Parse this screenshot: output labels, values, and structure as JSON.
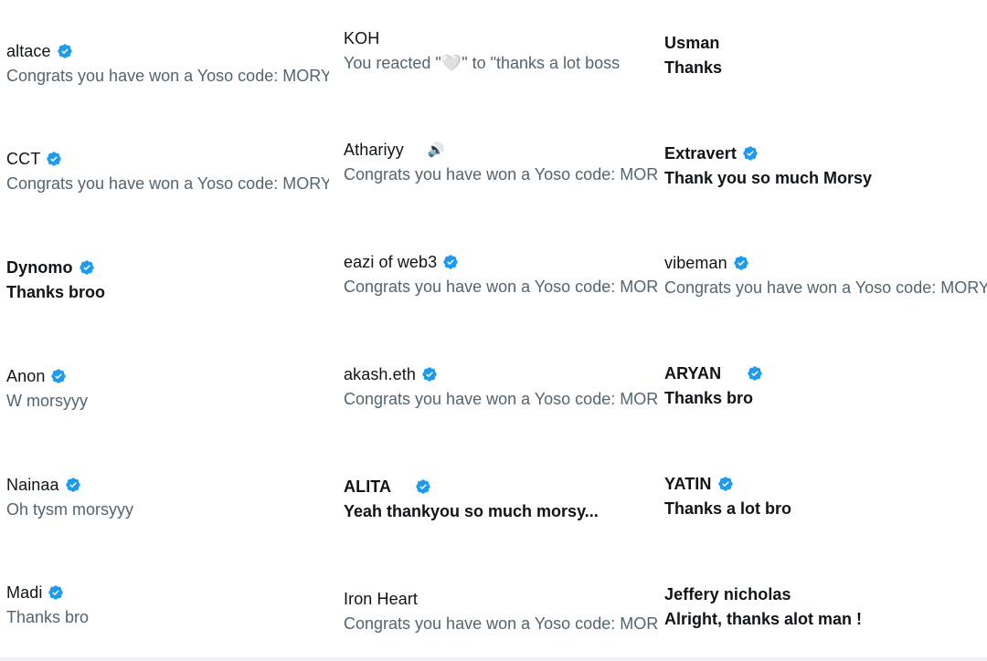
{
  "columns": [
    {
      "items": [
        {
          "name": "altace",
          "verified": true,
          "bold": false,
          "preview": "Congrats you have won a Yoso code: MORYSY",
          "unread": false
        },
        {
          "name": "CCT",
          "verified": true,
          "bold": false,
          "preview": "Congrats you have won a Yoso code: MORYSY",
          "unread": false
        },
        {
          "name": "Dynomo",
          "verified": true,
          "bold": true,
          "preview": "Thanks broo",
          "unread": true
        },
        {
          "name": "Anon",
          "verified": true,
          "bold": false,
          "preview": "W morsyyy",
          "unread": false
        },
        {
          "name": "Nainaa",
          "verified": true,
          "bold": false,
          "preview": "Oh tysm morsyyy",
          "unread": false
        },
        {
          "name": "Madi",
          "verified": true,
          "bold": false,
          "preview": "Thanks bro",
          "unread": false
        }
      ]
    },
    {
      "items": [
        {
          "name": "KOH",
          "verified": false,
          "bold": false,
          "preview": "You reacted \"🤍\" to \"thanks a lot boss",
          "unread": false
        },
        {
          "name": "Athariyy",
          "verified": false,
          "bold": false,
          "emoji": "🔊",
          "preview": "Congrats you have won a Yoso code: MORSY",
          "unread": false
        },
        {
          "name": "eazi of web3",
          "verified": true,
          "bold": false,
          "preview": "Congrats you have won a Yoso code: MORSY",
          "unread": false
        },
        {
          "name": "akash.eth",
          "verified": true,
          "bold": false,
          "preview": "Congrats you have won a Yoso code: MORSY",
          "unread": false
        },
        {
          "name": "ALITA",
          "verified": true,
          "bold": true,
          "gap": true,
          "preview": "Yeah thankyou so much morsy...",
          "unread": true
        },
        {
          "name": "Iron Heart",
          "verified": false,
          "bold": false,
          "preview": "Congrats you have won a Yoso code: MORSY",
          "unread": false
        }
      ]
    },
    {
      "items": [
        {
          "name": "Usman",
          "verified": false,
          "bold": true,
          "preview": "Thanks",
          "unread": true
        },
        {
          "name": "Extravert",
          "verified": true,
          "bold": true,
          "preview": "Thank you so much Morsy",
          "unread": true
        },
        {
          "name": "vibeman",
          "verified": true,
          "bold": false,
          "preview": "Congrats you have won a Yoso code: MORYSY",
          "unread": false
        },
        {
          "name": "ARYAN",
          "verified": true,
          "bold": true,
          "gap": true,
          "preview": "Thanks bro",
          "unread": true
        },
        {
          "name": "YATIN",
          "verified": true,
          "bold": true,
          "preview": "Thanks a lot bro",
          "unread": true
        },
        {
          "name": "Jeffery nicholas",
          "verified": false,
          "bold": true,
          "preview": "Alright, thanks alot man !",
          "unread": true
        }
      ]
    }
  ],
  "colors": {
    "verified": "#1d9bf0",
    "text": "#0f1419",
    "muted": "#536471"
  }
}
